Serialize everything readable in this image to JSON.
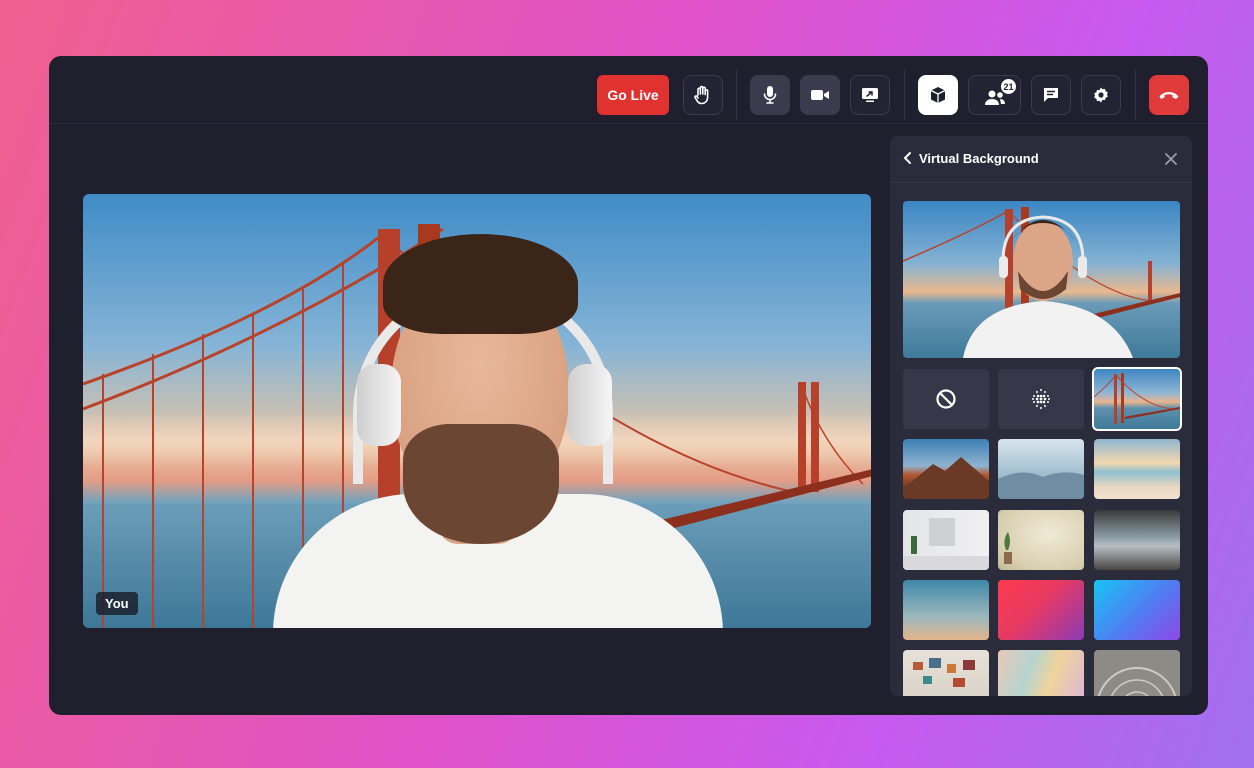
{
  "toolbar": {
    "go_live_label": "Go Live",
    "participants_count": "21",
    "icons": [
      "raise-hand-icon",
      "microphone-icon",
      "camera-icon",
      "screen-share-icon",
      "virtual-background-icon",
      "participants-icon",
      "chat-icon",
      "settings-icon",
      "end-call-icon"
    ]
  },
  "video": {
    "self_label": "You"
  },
  "panel": {
    "title": "Virtual Background",
    "options": [
      {
        "kind": "none",
        "icon": "no-background-icon"
      },
      {
        "kind": "blur",
        "icon": "blur-icon"
      },
      {
        "kind": "image",
        "name": "golden-gate",
        "selected": true
      },
      {
        "kind": "image",
        "name": "mountain-peak"
      },
      {
        "kind": "image",
        "name": "misty-hills"
      },
      {
        "kind": "image",
        "name": "beach-sunset"
      },
      {
        "kind": "image",
        "name": "white-room"
      },
      {
        "kind": "image",
        "name": "beige-wall-plant"
      },
      {
        "kind": "image",
        "name": "office-interior"
      },
      {
        "kind": "image",
        "name": "blue-gradient"
      },
      {
        "kind": "image",
        "name": "red-purple-gradient"
      },
      {
        "kind": "image",
        "name": "cyan-violet-gradient"
      },
      {
        "kind": "image",
        "name": "photo-wall"
      },
      {
        "kind": "image",
        "name": "pastel-mural"
      },
      {
        "kind": "image",
        "name": "dome-ceiling"
      }
    ]
  },
  "colors": {
    "accent_red": "#e0322f",
    "window_bg": "#1f1f2e",
    "panel_bg": "#2a2b3b"
  }
}
